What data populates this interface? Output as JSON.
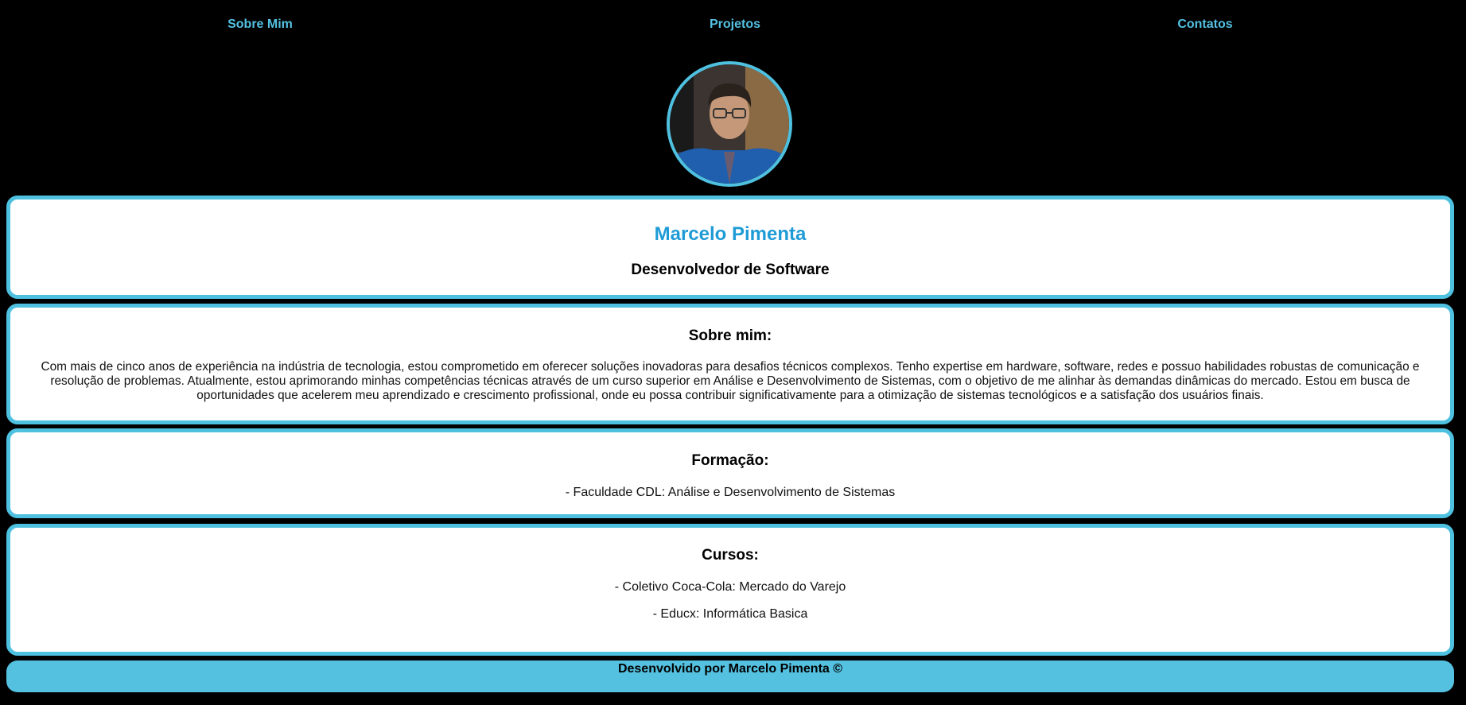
{
  "nav": {
    "items": [
      {
        "label": "Sobre Mim"
      },
      {
        "label": "Projetos"
      },
      {
        "label": "Contatos"
      }
    ]
  },
  "profile": {
    "name": "Marcelo Pimenta",
    "role": "Desenvolvedor de Software"
  },
  "about": {
    "title": "Sobre mim:",
    "text": "Com mais de cinco anos de experiência na indústria de tecnologia, estou comprometido em oferecer soluções inovadoras para desafios técnicos complexos. Tenho expertise em hardware, software, redes e possuo habilidades robustas de comunicação e resolução de problemas. Atualmente, estou aprimorando minhas competências técnicas através de um curso superior em Análise e Desenvolvimento de Sistemas, com o objetivo de me alinhar às demandas dinâmicas do mercado. Estou em busca de oportunidades que acelerem meu aprendizado e crescimento profissional, onde eu possa contribuir significativamente para a otimização de sistemas tecnológicos e a satisfação dos usuários finais."
  },
  "education": {
    "title": "Formação:",
    "items": [
      "- Faculdade CDL: Análise e Desenvolvimento de Sistemas"
    ]
  },
  "courses": {
    "title": "Cursos:",
    "items": [
      "- Coletivo Coca-Cola: Mercado do Varejo",
      "- Educx: Informática Basica"
    ]
  },
  "footer": {
    "text": "Desenvolvido por Marcelo Pimenta ©"
  },
  "colors": {
    "background": "#000000",
    "accent": "#4fc1e0",
    "name": "#1f9bd6",
    "card": "#ffffff"
  }
}
